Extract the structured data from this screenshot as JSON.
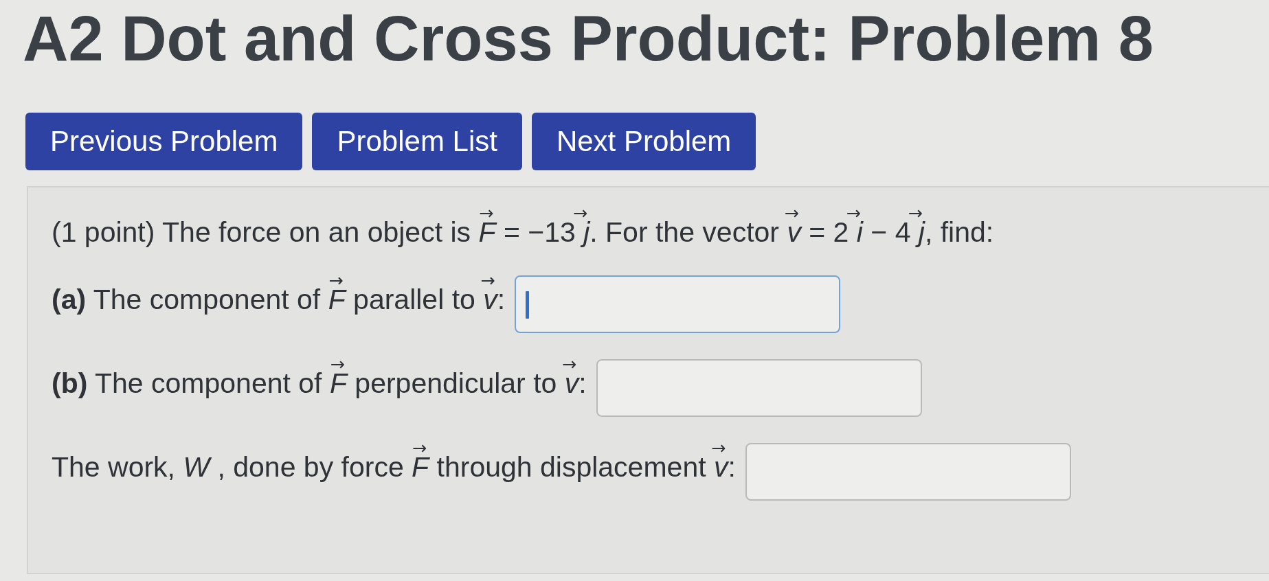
{
  "title": "A2 Dot and Cross Product: Problem 8",
  "nav_buttons": [
    {
      "label": "Previous Problem"
    },
    {
      "label": "Problem List"
    },
    {
      "label": "Next Problem"
    }
  ],
  "problem": {
    "statement": "(1 point) The force on an object is *F*$^{→}$ = −13 *j*$^{→}$. For the vector *v*$^{→}$ = 2 *i*$^{→}$ − 4 *j*$^{→}$, find:",
    "answers": [
      {
        "label": "**(a)** The component of *F*$^{→}$ parallel to *v*$^{→}$:",
        "focused": true
      },
      {
        "label": "**(b)** The component of *F*$^{→}$ perpendicular to *v*$^{→}$:",
        "focused": false
      },
      {
        "label": "The work, *W* , done by force *F*$^{→}$ through displacement *v*$^{→}$:",
        "focused": false
      }
    ]
  }
}
